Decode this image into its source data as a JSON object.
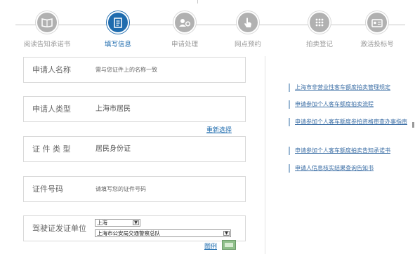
{
  "steps": [
    {
      "label": "阅读告知承诺书",
      "icon": "book-icon",
      "active": false
    },
    {
      "label": "填写信息",
      "icon": "form-icon",
      "active": true
    },
    {
      "label": "申请处理",
      "icon": "gear-user-icon",
      "active": false
    },
    {
      "label": "网点预约",
      "icon": "hand-pointer-icon",
      "active": false
    },
    {
      "label": "拍卖登记",
      "icon": "keypad-icon",
      "active": false
    },
    {
      "label": "激活投标号",
      "icon": "id-card-icon",
      "active": false
    }
  ],
  "form": {
    "applicant_name": {
      "label": "申请人名称",
      "value": "需与您证件上的名称一致"
    },
    "applicant_type": {
      "label": "申请人类型",
      "value": "上海市居民"
    },
    "reselect": "重新选择",
    "id_type": {
      "label": "证 件 类 型",
      "value": "居民身份证"
    },
    "id_number": {
      "label": "证件号码",
      "value": "请填写您的证件号码"
    },
    "license_issuer": {
      "label": "驾驶证发证单位",
      "city_select": "上海",
      "unit_select": "上海市公安局交通警察总队"
    },
    "example_link": "图例"
  },
  "links": [
    "上海市非营业性客车额度拍卖管理规定",
    "申请参加个人客车额度拍卖流程",
    "申请参加个人客车额度参拍资格审查办事指南",
    "申请参加个人客车额度拍卖告知承诺书",
    "申请人信息核实结果查询告知书"
  ],
  "colors": {
    "accent": "#1f6cae",
    "inactive_step": "#b1b1b1",
    "link": "#3b6ea5"
  }
}
